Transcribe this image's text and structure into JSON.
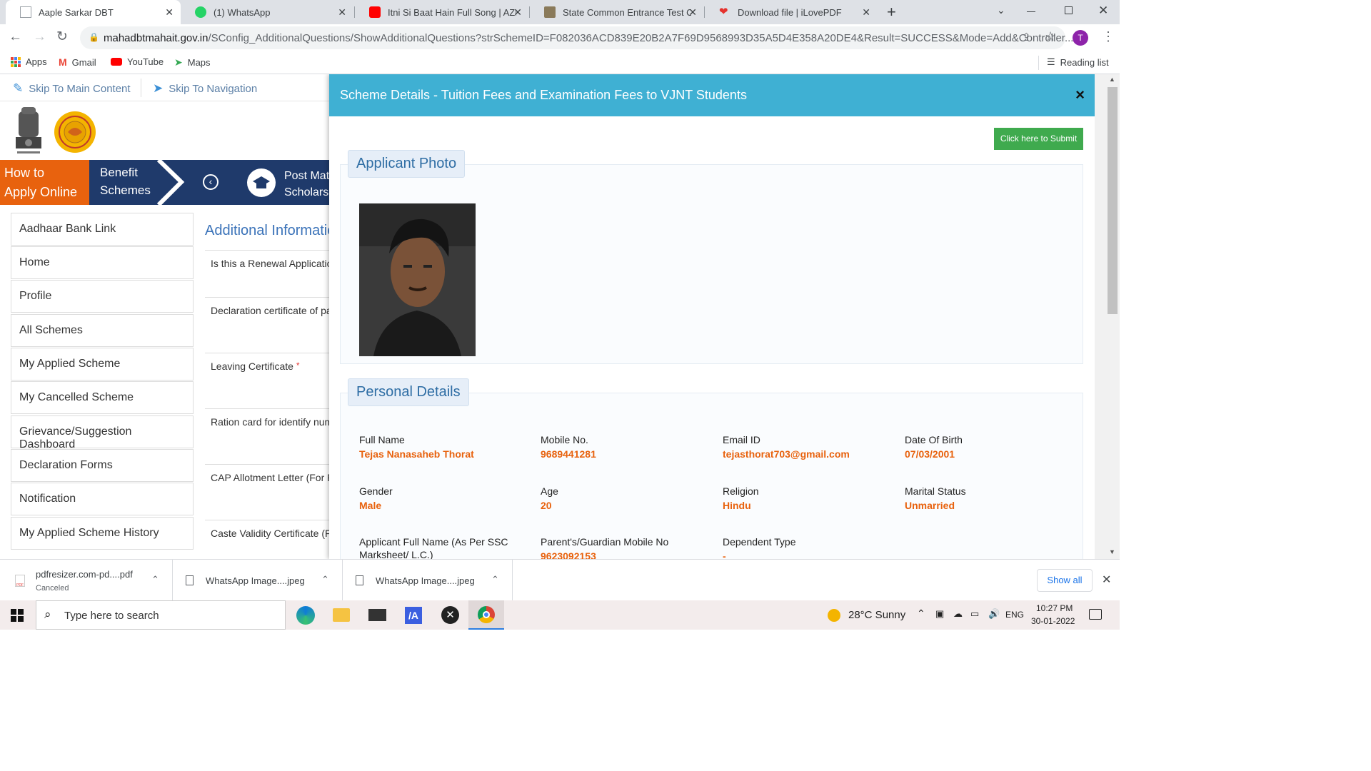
{
  "browser": {
    "tabs": [
      {
        "label": "Aaple Sarkar DBT",
        "active": true
      },
      {
        "label": "(1) WhatsApp",
        "active": false
      },
      {
        "label": "Itni Si Baat Hain Full Song | AZHA",
        "active": false
      },
      {
        "label": "State Common Entrance Test Cell",
        "active": false
      },
      {
        "label": "Download file | iLovePDF",
        "active": false
      }
    ],
    "url_host": "mahadbtmahait.gov.in",
    "url_path": "/SConfig_AdditionalQuestions/ShowAdditionalQuestions?strSchemeID=F082036ACD839E20B2A7F69D9568993D35A5D4E358A20DE4&Result=SUCCESS&Mode=Add&Controller...",
    "profile_initial": "T",
    "bookmarks": [
      "Apps",
      "Gmail",
      "YouTube",
      "Maps"
    ],
    "reading_list": "Reading list"
  },
  "site": {
    "skip_main": "Skip To Main Content",
    "skip_nav": "Skip To Navigation",
    "how_to_line1": "How to",
    "how_to_line2": "Apply Online ?",
    "benefit_line1": "Benefit",
    "benefit_line2": "Schemes",
    "post_matric_line1": "Post Matri",
    "post_matric_line2": "Scholarsh",
    "sidebar": [
      "Aadhaar Bank Link",
      "Home",
      "Profile",
      "All Schemes",
      "My Applied Scheme",
      "My Cancelled Scheme",
      "Grievance/Suggestion Dashboard",
      "Declaration Forms",
      "Notification",
      "My Applied Scheme History"
    ],
    "additional_title": "Additional Informatio",
    "questions": [
      "Is this a Renewal Application",
      "Declaration certificate of pa",
      "Leaving Certificate",
      "Ration card for identify num",
      "CAP Allotment Letter (For Pr",
      "Caste Validity Certificate (Fo"
    ],
    "required_mark": "*"
  },
  "modal": {
    "title": "Scheme Details - Tuition Fees and Examination Fees to VJNT Students",
    "close": "×",
    "submit": "Click here to Submit",
    "photo_legend": "Applicant Photo",
    "personal_legend": "Personal Details",
    "fields": [
      {
        "label": "Full Name",
        "value": "Tejas Nanasaheb Thorat"
      },
      {
        "label": "Mobile No.",
        "value": "9689441281"
      },
      {
        "label": "Email ID",
        "value": "tejasthorat703@gmail.com"
      },
      {
        "label": "Date Of Birth",
        "value": "07/03/2001"
      },
      {
        "label": "Gender",
        "value": "Male"
      },
      {
        "label": "Age",
        "value": "20"
      },
      {
        "label": "Religion",
        "value": "Hindu"
      },
      {
        "label": "Marital Status",
        "value": "Unmarried"
      },
      {
        "label": "Applicant Full Name (As Per SSC Marksheet/ L.C.)",
        "value": ""
      },
      {
        "label": "Parent's/Guardian Mobile No",
        "value": "9623092153"
      },
      {
        "label": "Dependent Type",
        "value": "-"
      }
    ]
  },
  "downloads": [
    {
      "name": "pdfresizer.com-pd....pdf",
      "status": "Canceled"
    },
    {
      "name": "WhatsApp Image....jpeg",
      "status": ""
    },
    {
      "name": "WhatsApp Image....jpeg",
      "status": ""
    }
  ],
  "show_all": "Show all",
  "taskbar": {
    "search_placeholder": "Type here to search",
    "weather": "28°C  Sunny",
    "lang": "ENG",
    "time": "10:27 PM",
    "date": "30-01-2022"
  },
  "colors": {
    "accent": "#3fb0d3",
    "orange": "#e8620e",
    "navy": "#1f3a6b",
    "submit": "#3faa4e"
  }
}
